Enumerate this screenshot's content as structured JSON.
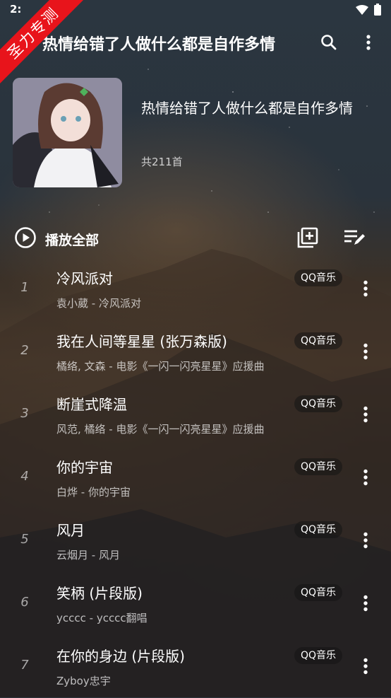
{
  "status_bar": {
    "time": "2:",
    "icons": [
      "wifi-icon",
      "battery-icon"
    ]
  },
  "ribbon": {
    "text": "圣力专测"
  },
  "app_bar": {
    "title": "热情给错了人做什么都是自作多情",
    "actions": [
      "search-icon",
      "more-vert-icon"
    ]
  },
  "playlist": {
    "title": "热情给错了人做什么都是自作多情",
    "count": "共211首"
  },
  "controls": {
    "play_all_label": "播放全部",
    "icons": [
      "play-circle-icon",
      "add-to-queue-icon",
      "edit-list-icon"
    ]
  },
  "songs": [
    {
      "index": "1",
      "title": "冷风派对",
      "subtitle": "袁小葳 - 冷风派对",
      "source": "QQ音乐"
    },
    {
      "index": "2",
      "title": "我在人间等星星 (张万森版)",
      "subtitle": "橘络, 文森 - 电影《一闪一闪亮星星》应援曲",
      "source": "QQ音乐"
    },
    {
      "index": "3",
      "title": "断崖式降温",
      "subtitle": "风范, 橘络 - 电影《一闪一闪亮星星》应援曲",
      "source": "QQ音乐"
    },
    {
      "index": "4",
      "title": "你的宇宙",
      "subtitle": "白烨 - 你的宇宙",
      "source": "QQ音乐"
    },
    {
      "index": "5",
      "title": "风月",
      "subtitle": "云烟月 - 风月",
      "source": "QQ音乐"
    },
    {
      "index": "6",
      "title": "笑柄 (片段版)",
      "subtitle": "ycccc - ycccc翻唱",
      "source": "QQ音乐"
    },
    {
      "index": "7",
      "title": "在你的身边 (片段版)",
      "subtitle": "Zyboy忠宇",
      "source": "QQ音乐"
    }
  ]
}
